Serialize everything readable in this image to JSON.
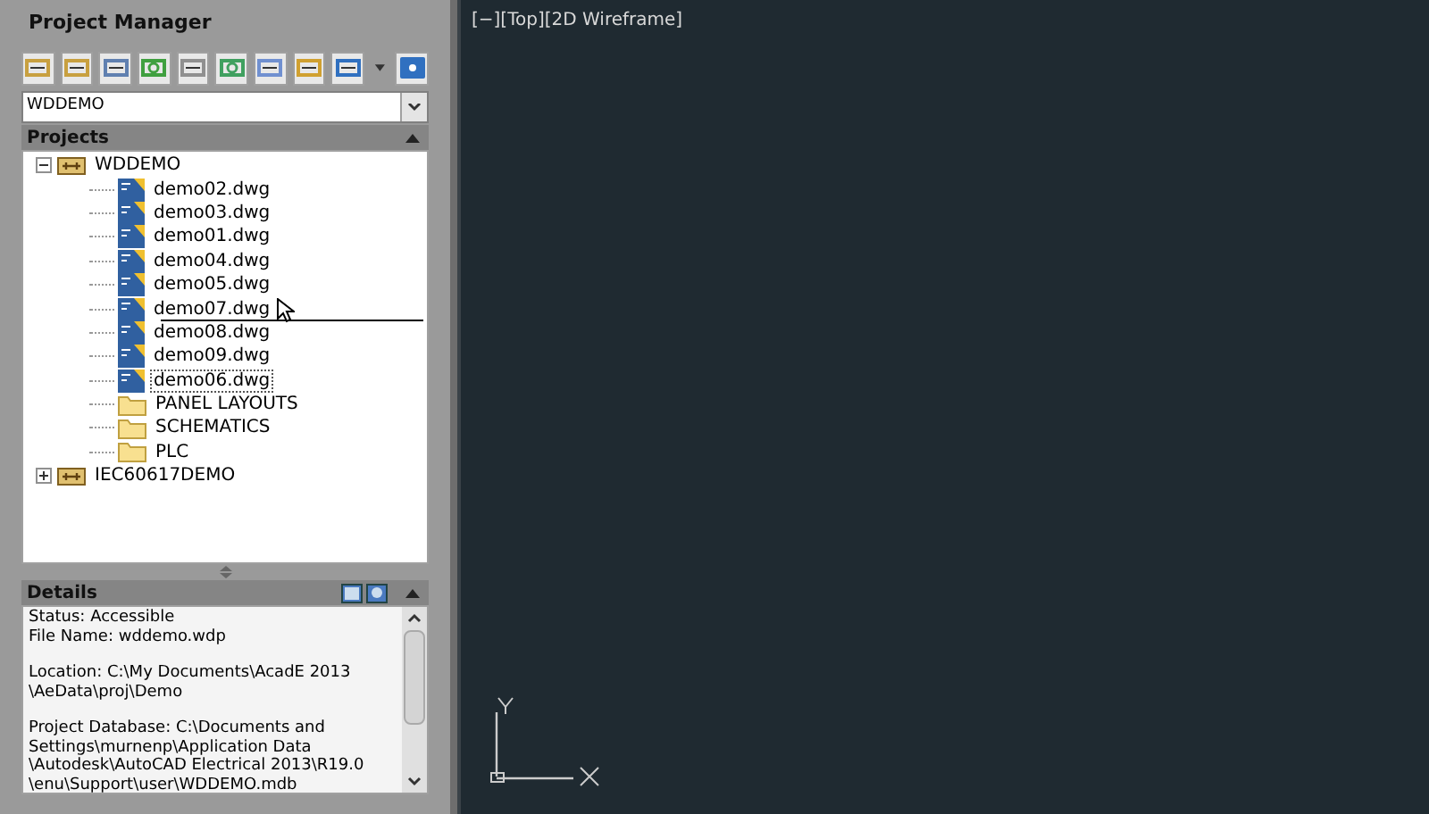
{
  "panel": {
    "title": "Project Manager"
  },
  "project_combo": {
    "value": "WDDEMO"
  },
  "projects": {
    "header": "Projects",
    "tree": [
      {
        "label": "WDDEMO",
        "kind": "project",
        "expanded": true,
        "selected": false,
        "children": [
          {
            "label": "demo02.dwg",
            "kind": "drawing",
            "selected": false
          },
          {
            "label": "demo03.dwg",
            "kind": "drawing",
            "selected": false
          },
          {
            "label": "demo01.dwg",
            "kind": "drawing",
            "selected": false
          },
          {
            "label": "demo04.dwg",
            "kind": "drawing",
            "selected": false
          },
          {
            "label": "demo05.dwg",
            "kind": "drawing",
            "selected": false
          },
          {
            "label": "demo07.dwg",
            "kind": "drawing",
            "selected": false
          },
          {
            "label": "demo08.dwg",
            "kind": "drawing",
            "selected": false
          },
          {
            "label": "demo09.dwg",
            "kind": "drawing",
            "selected": false
          },
          {
            "label": "demo06.dwg",
            "kind": "drawing",
            "selected": true
          },
          {
            "label": "PANEL LAYOUTS",
            "kind": "folder",
            "selected": false
          },
          {
            "label": "SCHEMATICS",
            "kind": "folder",
            "selected": false
          },
          {
            "label": "PLC",
            "kind": "folder",
            "selected": false
          }
        ]
      },
      {
        "label": "IEC60617DEMO",
        "kind": "project",
        "expanded": false,
        "selected": false
      }
    ]
  },
  "details": {
    "header": "Details",
    "sections": [
      [
        "Status: Accessible",
        "File Name: wddemo.wdp"
      ],
      [
        "Location: C:\\My Documents\\AcadE 2013",
        "\\AeData\\proj\\Demo"
      ],
      [
        "Project Database: C:\\Documents and",
        "Settings\\murnenp\\Application Data",
        "\\Autodesk\\AutoCAD Electrical 2013\\R19.0",
        "\\enu\\Support\\user\\WDDEMO.mdb"
      ]
    ]
  },
  "viewport": {
    "label": "[−][Top][2D Wireframe]"
  }
}
